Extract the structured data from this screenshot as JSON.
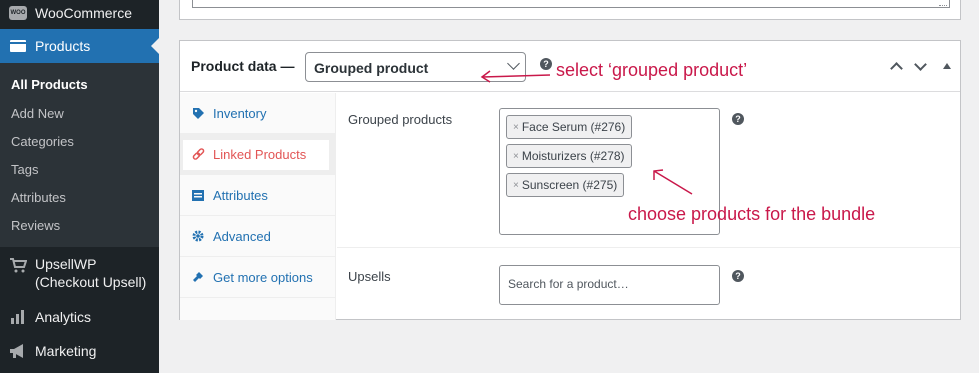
{
  "sidebar": {
    "woocommerce": {
      "label": "WooCommerce",
      "icon": "woocommerce-icon",
      "badge": "WOO"
    },
    "products": {
      "label": "Products",
      "icon": "products-icon"
    },
    "submenu": [
      "All Products",
      "Add New",
      "Categories",
      "Tags",
      "Attributes",
      "Reviews"
    ],
    "upsellwp": {
      "label_line1": "UpsellWP",
      "label_line2": "(Checkout Upsell)",
      "icon": "cart-icon"
    },
    "analytics": {
      "label": "Analytics",
      "icon": "bar-chart-icon"
    },
    "marketing": {
      "label": "Marketing",
      "icon": "megaphone-icon"
    }
  },
  "product_data": {
    "title": "Product data —",
    "type_value": "Grouped product",
    "help": "?",
    "tabs": [
      {
        "label": "Inventory",
        "icon": "tag-icon"
      },
      {
        "label": "Linked Products",
        "icon": "link-icon",
        "active": true
      },
      {
        "label": "Attributes",
        "icon": "list-icon"
      },
      {
        "label": "Advanced",
        "icon": "gear-icon"
      },
      {
        "label": "Get more options",
        "icon": "plugin-icon"
      }
    ],
    "grouped_label": "Grouped products",
    "grouped_items": [
      "Face Serum (#276)",
      "Moisturizers (#278)",
      "Sunscreen (#275)"
    ],
    "token_remove": "×",
    "upsells_label": "Upsells",
    "upsells_placeholder": "Search for a product…"
  },
  "annotations": {
    "select_note": "select ‘grouped product’",
    "choose_note": "choose products for the bundle",
    "color": "#c9184a"
  },
  "colors": {
    "sidebar_bg": "#1d2327",
    "active_blue": "#2271b1",
    "active_tab_red": "#e25555"
  }
}
